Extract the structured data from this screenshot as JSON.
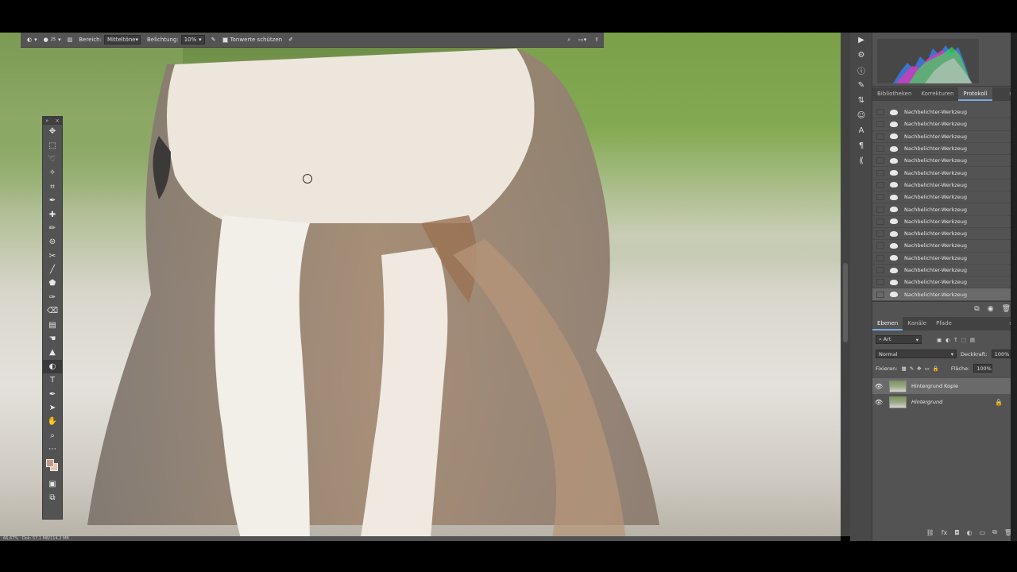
{
  "options_bar": {
    "range_label": "Bereich:",
    "range_value": "Mitteltöne",
    "exposure_label": "Belichtung:",
    "exposure_value": "10%",
    "protect_tones_label": "Tonwerte schützen",
    "brush_size": "25"
  },
  "status_bar": {
    "zoom": "66,67%",
    "doc_info": "Dok: 57,1 MB/114,2 MB"
  },
  "panels": {
    "history_tabs": [
      "Bibliotheken",
      "Korrekturen",
      "Protokoll"
    ],
    "history_active_tab": "Protokoll",
    "history_items": [
      "Nachbelichter-Werkzeug",
      "Nachbelichter-Werkzeug",
      "Nachbelichter-Werkzeug",
      "Nachbelichter-Werkzeug",
      "Nachbelichter-Werkzeug",
      "Nachbelichter-Werkzeug",
      "Nachbelichter-Werkzeug",
      "Nachbelichter-Werkzeug",
      "Nachbelichter-Werkzeug",
      "Nachbelichter-Werkzeug",
      "Nachbelichter-Werkzeug",
      "Nachbelichter-Werkzeug",
      "Nachbelichter-Werkzeug",
      "Nachbelichter-Werkzeug",
      "Nachbelichter-Werkzeug",
      "Nachbelichter-Werkzeug"
    ],
    "layers_tabs": [
      "Ebenen",
      "Kanäle",
      "Pfade"
    ],
    "layers_active_tab": "Ebenen",
    "filter_label": "Art",
    "blend_mode": "Normal",
    "opacity_label": "Deckkraft:",
    "opacity_value": "100%",
    "lock_label": "Fixieren:",
    "fill_label": "Fläche:",
    "fill_value": "100%",
    "layers": [
      {
        "name": "Hintergrund Kopie",
        "selected": true,
        "locked": false
      },
      {
        "name": "Hintergrund",
        "selected": false,
        "locked": true
      }
    ]
  },
  "colors": {
    "foreground": "#c29a88",
    "background": "#e8c4b2",
    "panel": "#535353"
  }
}
